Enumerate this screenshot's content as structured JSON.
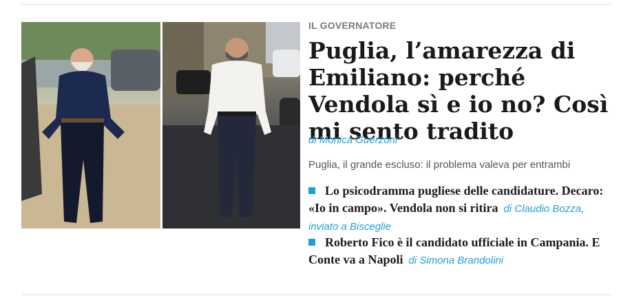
{
  "article": {
    "kicker": "IL GOVERNATORE",
    "headline": "Puglia, l’amarezza di Emiliano: perché Vendola sì e io no? Così mi sento tradito",
    "byline": "di Monica Guerzoni",
    "summary": "Puglia, il grande escluso: il problema valeva per entrambi"
  },
  "related": [
    {
      "title": "Lo psicodramma pugliese delle candidature. Decaro: «Io in campo». Vendola non si ritira",
      "author": "di Claudio Bozza, inviato a Bisceglie"
    },
    {
      "title": "Roberto Fico è il candidato ufficiale in Campania. E Conte va a Napoli",
      "author": "di Simona Brandolini"
    }
  ],
  "colors": {
    "accent": "#1f9fd8",
    "kicker": "#7a7a7a",
    "text": "#1a1a1a"
  }
}
